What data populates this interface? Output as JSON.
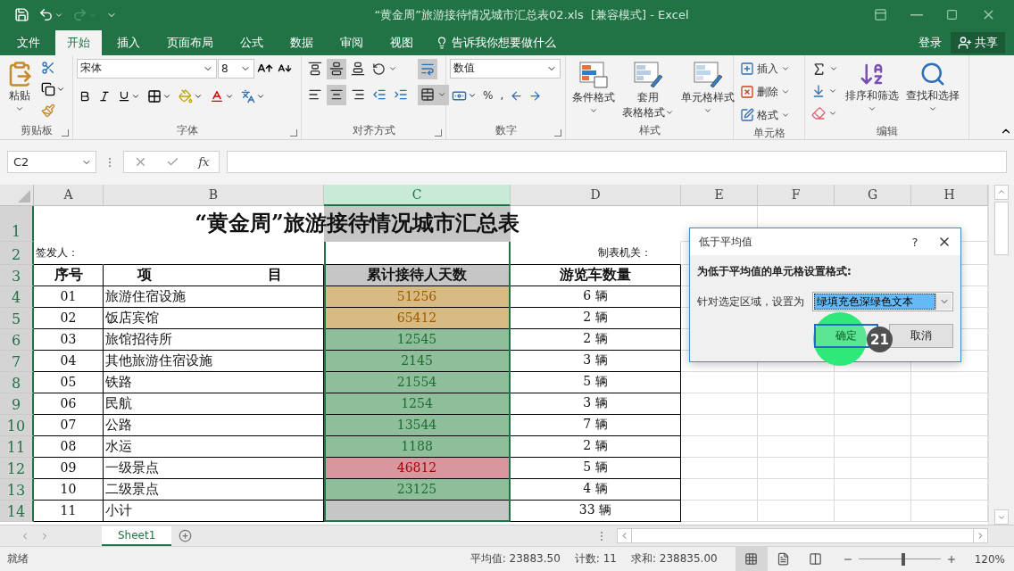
{
  "window": {
    "title": "“黄金周”旅游接待情况城市汇总表02.xls  [兼容模式] - Excel"
  },
  "tabs": [
    {
      "label": "文件",
      "selected": false
    },
    {
      "label": "开始",
      "selected": true
    },
    {
      "label": "插入",
      "selected": false
    },
    {
      "label": "页面布局",
      "selected": false
    },
    {
      "label": "公式",
      "selected": false
    },
    {
      "label": "数据",
      "selected": false
    },
    {
      "label": "审阅",
      "selected": false
    },
    {
      "label": "视图",
      "selected": false
    }
  ],
  "tell_me": "告诉我你想要做什么",
  "account": {
    "sign_in": "登录",
    "share": "共享"
  },
  "ribbon": {
    "clipboard": {
      "paste": "粘贴",
      "label": "剪贴板"
    },
    "font": {
      "name": "宋体",
      "size": "8",
      "label": "字体"
    },
    "alignment": {
      "label": "对齐方式"
    },
    "number": {
      "format": "数值",
      "percent": "%",
      "comma": ",",
      "label": "数字"
    },
    "styles": {
      "buttons": [
        {
          "lines": [
            "条件格式"
          ]
        },
        {
          "lines": [
            "套用",
            "表格格式"
          ]
        },
        {
          "lines": [
            "单元格样式"
          ]
        }
      ],
      "label": "样式"
    },
    "cells": {
      "buttons": [
        "插入",
        "删除",
        "格式"
      ],
      "label": "单元格"
    },
    "editing": {
      "buttons": [
        "排序和筛选",
        "查找和选择"
      ],
      "label": "编辑"
    }
  },
  "formula_bar": {
    "name_box": "C2",
    "function_label": "fx"
  },
  "sheet": {
    "columns": [
      {
        "label": "A",
        "selected": false
      },
      {
        "label": "B",
        "selected": false
      },
      {
        "label": "C",
        "selected": true
      },
      {
        "label": "D",
        "selected": false
      },
      {
        "label": "E",
        "selected": false
      },
      {
        "label": "F",
        "selected": false
      },
      {
        "label": "G",
        "selected": false
      },
      {
        "label": "H",
        "selected": false
      }
    ],
    "row_numbers": [
      {
        "label": "1",
        "selected": true
      },
      {
        "label": "2",
        "selected": true
      },
      {
        "label": "3",
        "selected": true
      },
      {
        "label": "4",
        "selected": true
      },
      {
        "label": "5",
        "selected": true
      },
      {
        "label": "6",
        "selected": true
      },
      {
        "label": "7",
        "selected": true
      },
      {
        "label": "8",
        "selected": true
      },
      {
        "label": "9",
        "selected": true
      },
      {
        "label": "10",
        "selected": true
      },
      {
        "label": "11",
        "selected": true
      },
      {
        "label": "12",
        "selected": true
      },
      {
        "label": "13",
        "selected": true
      },
      {
        "label": "14",
        "selected": true
      }
    ],
    "title": "“黄金周”旅游接待情况城市汇总表",
    "issuer_label": "签发人：",
    "office_label": "制表机关：",
    "headers": [
      "序号",
      "项目",
      "累计接待人天数",
      "游览车数量"
    ],
    "rows": [
      {
        "no": "01",
        "item": "旅游住宿设施",
        "visitors": "51256",
        "kind": "neutral",
        "cars": "6 辆"
      },
      {
        "no": "02",
        "item": "饭店宾馆",
        "visitors": "65412",
        "kind": "neutral",
        "cars": "2 辆"
      },
      {
        "no": "03",
        "item": "旅馆招待所",
        "visitors": "12545",
        "kind": "good",
        "cars": "2 辆"
      },
      {
        "no": "04",
        "item": "其他旅游住宿设施",
        "visitors": "2145",
        "kind": "good",
        "cars": "3 辆"
      },
      {
        "no": "05",
        "item": "铁路",
        "visitors": "21554",
        "kind": "good",
        "cars": "5 辆"
      },
      {
        "no": "06",
        "item": "民航",
        "visitors": "1254",
        "kind": "good",
        "cars": "3 辆"
      },
      {
        "no": "07",
        "item": "公路",
        "visitors": "13544",
        "kind": "good",
        "cars": "7 辆"
      },
      {
        "no": "08",
        "item": "水运",
        "visitors": "1188",
        "kind": "good",
        "cars": "2 辆"
      },
      {
        "no": "09",
        "item": "一级景点",
        "visitors": "46812",
        "kind": "bad",
        "cars": "5 辆"
      },
      {
        "no": "10",
        "item": "二级景点",
        "visitors": "23125",
        "kind": "good",
        "cars": "4 辆"
      },
      {
        "no": "11",
        "item": "小计",
        "kind": "none",
        "cars": "33 辆"
      }
    ]
  },
  "sheet_tabs": [
    {
      "label": "Sheet1",
      "selected": true
    }
  ],
  "status_bar": {
    "mode": "就绪",
    "average": "平均值: 23883.50",
    "count": "计数: 11",
    "sum": "求和: 238835.00",
    "views": [
      {
        "kind": "normal",
        "selected": true
      },
      {
        "kind": "page_layout",
        "selected": false
      },
      {
        "kind": "page_break",
        "selected": false
      }
    ],
    "zoom": {
      "level": 0.55,
      "reading": "120%"
    }
  },
  "dialog": {
    "title": "低于平均值",
    "help": "?",
    "prompt": "为低于平均值的单元格设置格式:",
    "field_label": "针对选定区域，设置为",
    "value": "绿填充色深绿色文本",
    "buttons": [
      {
        "label": "确定",
        "focused": true
      },
      {
        "label": "取消",
        "focused": false
      }
    ]
  },
  "click_marker": {
    "step": "21"
  }
}
